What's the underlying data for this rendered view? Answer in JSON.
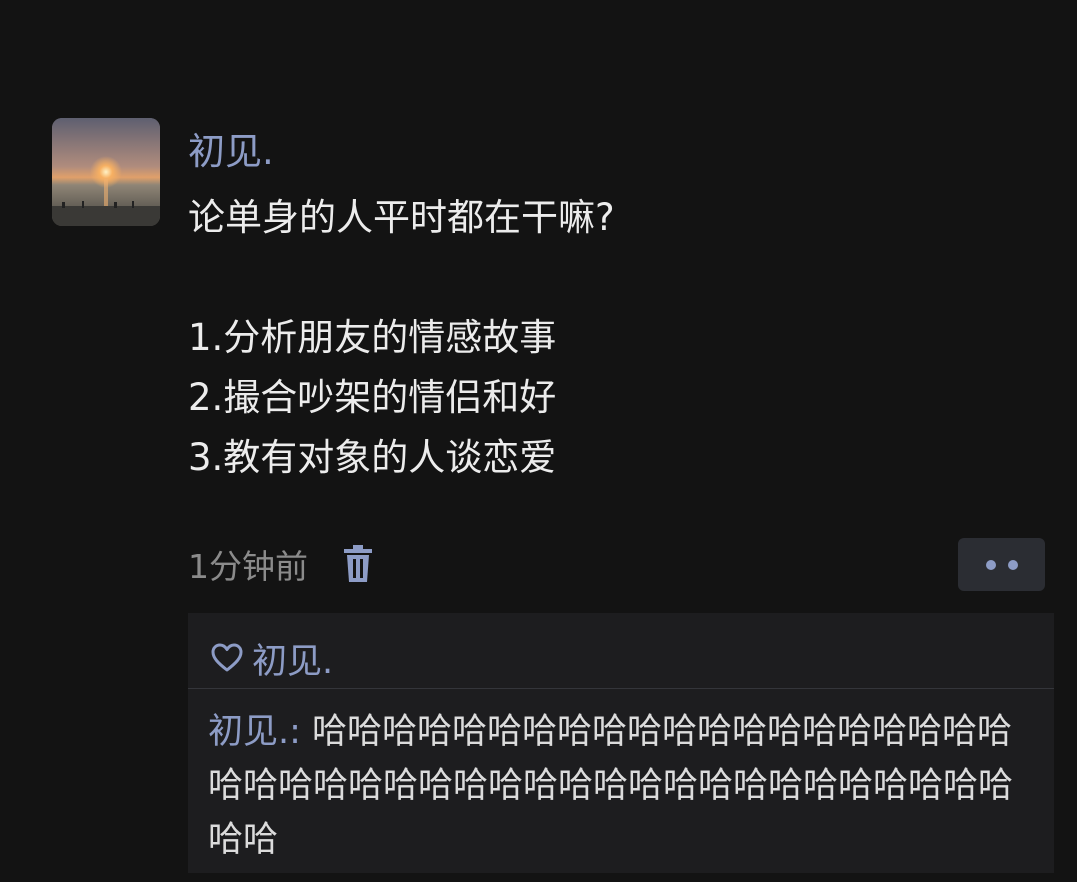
{
  "post": {
    "author": "初见.",
    "avatar_icon": "sunset-photo",
    "content_lines": [
      "论单身的人平时都在干嘛?",
      "",
      "1.分析朋友的情感故事",
      "2.撮合吵架的情侣和好",
      "3.教有对象的人谈恋爱"
    ],
    "time": "1分钟前",
    "delete_icon": "trash-icon",
    "more_icon": "more-dots-icon"
  },
  "likes": {
    "icon": "heart-icon",
    "names": "初见."
  },
  "comment": {
    "author": "初见.:",
    "text": " 哈哈哈哈哈哈哈哈哈哈哈哈哈哈哈哈哈哈哈哈哈哈哈哈哈哈哈哈哈哈哈哈哈哈哈哈哈哈哈哈哈哈哈哈哈"
  },
  "colors": {
    "background": "#131313",
    "name_accent": "#8d9cc6",
    "text": "#ececec",
    "muted": "#8b8b8b",
    "panel": "#1d1d1f"
  }
}
